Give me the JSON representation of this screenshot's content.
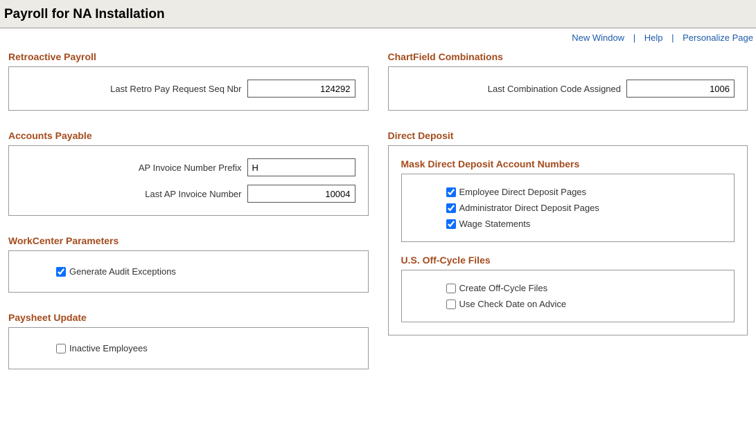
{
  "header": {
    "title": "Payroll for NA Installation",
    "links": {
      "newWindow": "New Window",
      "help": "Help",
      "personalize": "Personalize Page"
    }
  },
  "retro": {
    "title": "Retroactive Payroll",
    "lastSeqLabel": "Last Retro Pay Request Seq Nbr",
    "lastSeqValue": "124292"
  },
  "ap": {
    "title": "Accounts Payable",
    "prefixLabel": "AP Invoice Number Prefix",
    "prefixValue": "H",
    "lastInvLabel": "Last AP Invoice Number",
    "lastInvValue": "10004"
  },
  "workcenter": {
    "title": "WorkCenter Parameters",
    "genAuditLabel": "Generate Audit Exceptions",
    "genAuditChecked": true
  },
  "paysheet": {
    "title": "Paysheet Update",
    "inactiveLabel": "Inactive Employees",
    "inactiveChecked": false
  },
  "chartfield": {
    "title": "ChartField Combinations",
    "lastCodeLabel": "Last Combination Code Assigned",
    "lastCodeValue": "1006"
  },
  "direct": {
    "title": "Direct Deposit",
    "mask": {
      "title": "Mask Direct Deposit Account Numbers",
      "empLabel": "Employee Direct Deposit Pages",
      "empChecked": true,
      "adminLabel": "Administrator Direct Deposit Pages",
      "adminChecked": true,
      "wageLabel": "Wage Statements",
      "wageChecked": true
    },
    "offcycle": {
      "title": "U.S. Off-Cycle Files",
      "createLabel": "Create Off-Cycle Files",
      "createChecked": false,
      "useCheckLabel": "Use Check Date on Advice",
      "useCheckChecked": false
    }
  }
}
